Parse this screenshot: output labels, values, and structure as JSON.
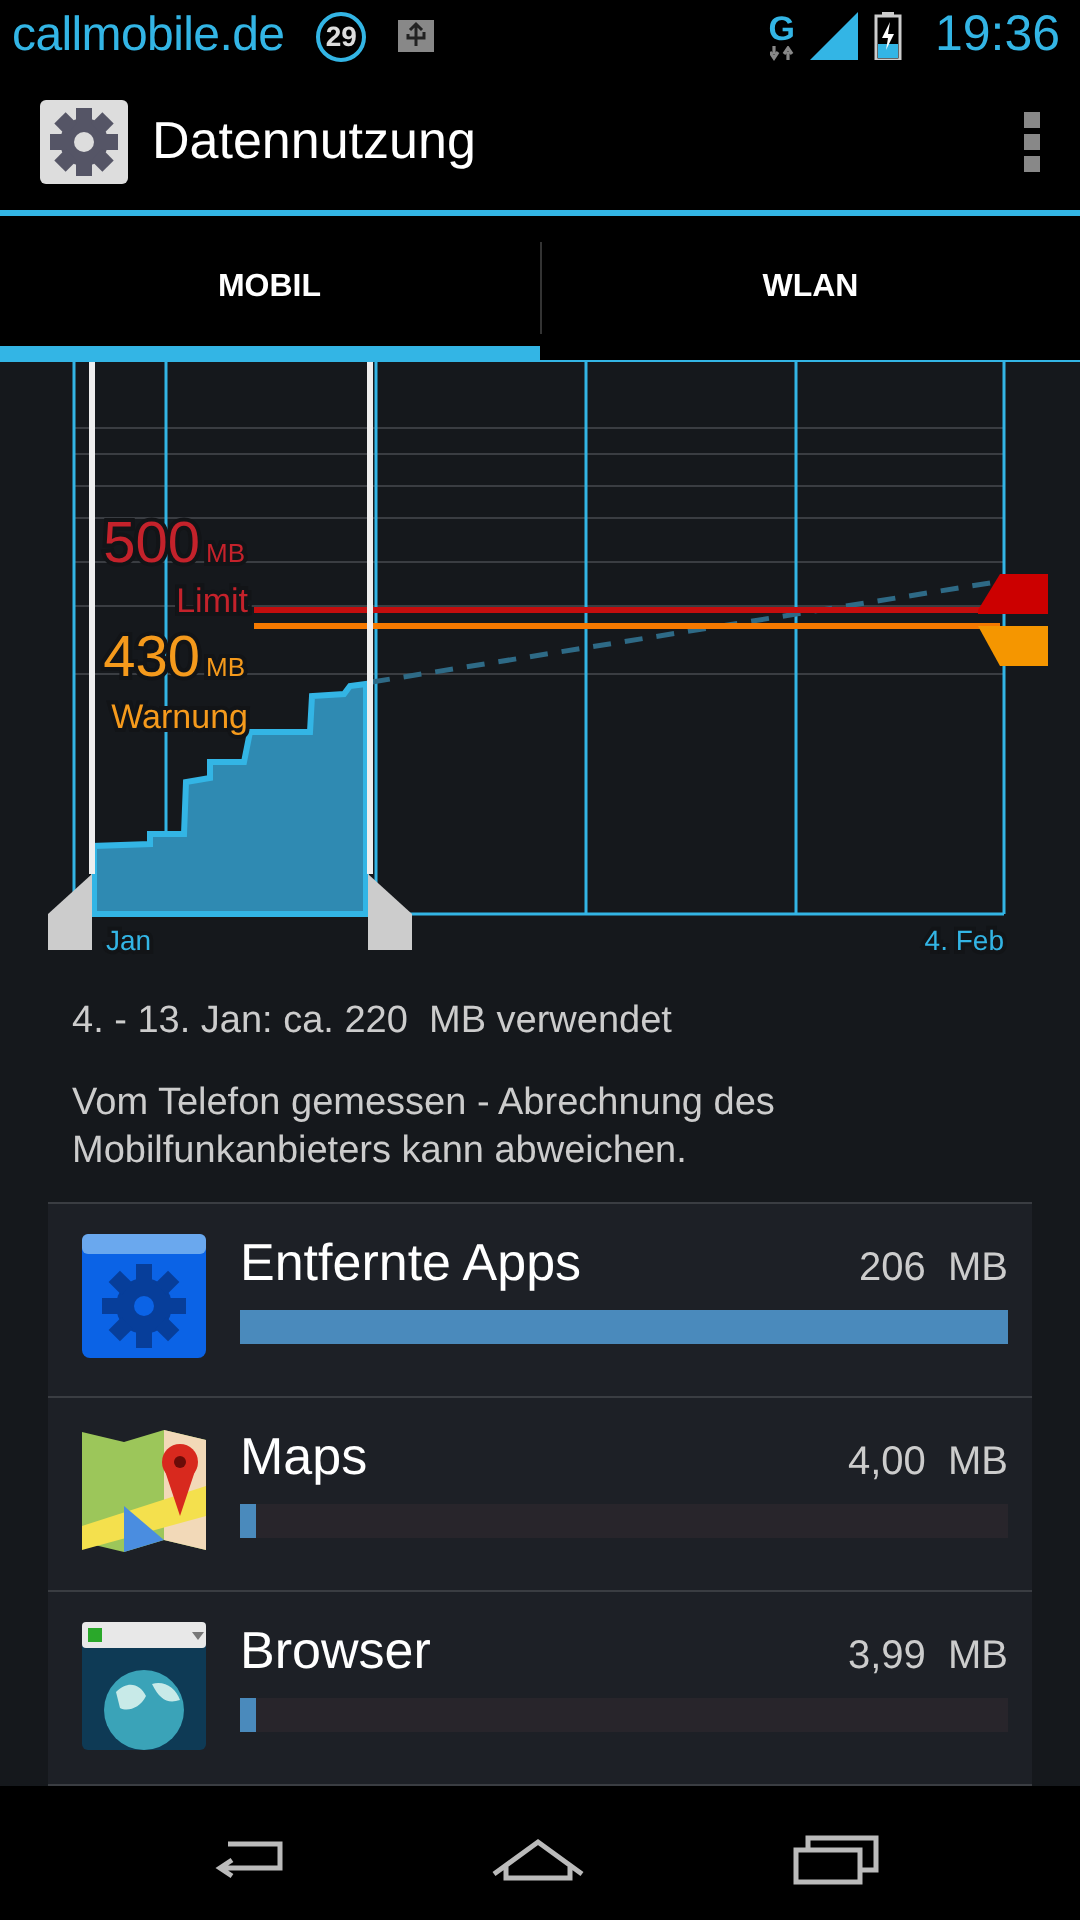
{
  "status_bar": {
    "carrier": "callmobile.de",
    "notification_count": "29",
    "network": "G",
    "time": "19:36"
  },
  "action_bar": {
    "title": "Datennutzung"
  },
  "tabs": [
    {
      "label": "MOBIL",
      "selected": true
    },
    {
      "label": "WLAN",
      "selected": false
    }
  ],
  "usage_graph": {
    "limit": {
      "value": "500",
      "unit": "MB",
      "label": "Limit"
    },
    "warning": {
      "value": "430",
      "unit": "MB",
      "label": "Warnung"
    },
    "start_label": "Jan",
    "end_label": "4. Feb"
  },
  "summary": "4. - 13. Jan: ca. 220  MB verwendet",
  "note": "Vom Telefon gemessen - Abrechnung des Mobilfunkanbieters kann abweichen.",
  "apps": [
    {
      "kind": "settings",
      "name": "Entfernte Apps",
      "usage": "206  MB",
      "level": 1.0
    },
    {
      "kind": "maps",
      "name": "Maps",
      "usage": "4,00  MB",
      "level": 0.02
    },
    {
      "kind": "browser",
      "name": "Browser",
      "usage": "3,99  MB",
      "level": 0.02
    }
  ]
}
